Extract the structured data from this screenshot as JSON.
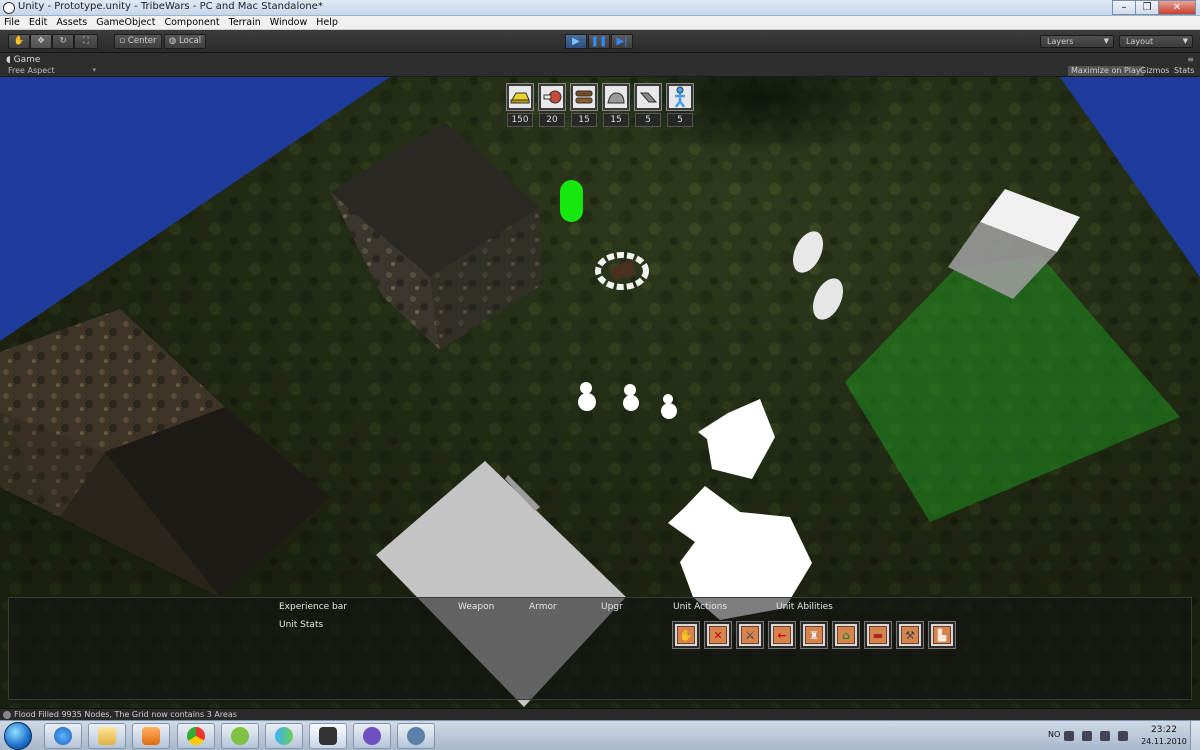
{
  "window": {
    "title": "Unity - Prototype.unity - TribeWars - PC and Mac Standalone*",
    "minimize": "–",
    "maximize": "❐",
    "close": "✕"
  },
  "menu": [
    "File",
    "Edit",
    "Assets",
    "GameObject",
    "Component",
    "Terrain",
    "Window",
    "Help"
  ],
  "toolbar": {
    "pivot_label": "Center",
    "space_label": "Local",
    "layers_label": "Layers",
    "layout_label": "Layout"
  },
  "game_tab": {
    "name": "Game",
    "aspect": "Free Aspect",
    "maximize_on_play": "Maximize on Play",
    "gizmos": "Gizmos",
    "stats": "Stats"
  },
  "resources": [
    {
      "icon": "gold-icon",
      "count": "150"
    },
    {
      "icon": "meat-icon",
      "count": "20"
    },
    {
      "icon": "wood-icon",
      "count": "15"
    },
    {
      "icon": "stone-icon",
      "count": "15"
    },
    {
      "icon": "metal-icon",
      "count": "5"
    },
    {
      "icon": "population-icon",
      "count": "5"
    }
  ],
  "hud": {
    "experience_bar": "Experience bar",
    "unit_stats": "Unit Stats",
    "weapon": "Weapon",
    "armor": "Armor",
    "upgr": "Upgr",
    "unit_actions": "Unit Actions",
    "unit_abilities": "Unit Abilities"
  },
  "actions": [
    {
      "name": "gather-action",
      "glyph": "✋"
    },
    {
      "name": "stop-action",
      "glyph": "✕"
    },
    {
      "name": "attack-action",
      "glyph": "⚔"
    },
    {
      "name": "move-back-action",
      "glyph": "←"
    },
    {
      "name": "build-castle-ability",
      "glyph": "♜"
    },
    {
      "name": "build-hut-ability",
      "glyph": "⌂"
    },
    {
      "name": "build-barracks-ability",
      "glyph": "▬"
    },
    {
      "name": "build-workshop-ability",
      "glyph": "⚒"
    },
    {
      "name": "build-tower-ability",
      "glyph": "▙"
    }
  ],
  "status": {
    "message": "Flood Filled 9935 Nodes, The Grid now contains 3 Areas"
  },
  "taskbar": {
    "language": "NO",
    "time": "23:22",
    "date": "24.11.2010"
  },
  "colors": {
    "accent_play": "#2f8cff",
    "unit_green": "#16e80f",
    "action_orange": "#d4854f"
  }
}
